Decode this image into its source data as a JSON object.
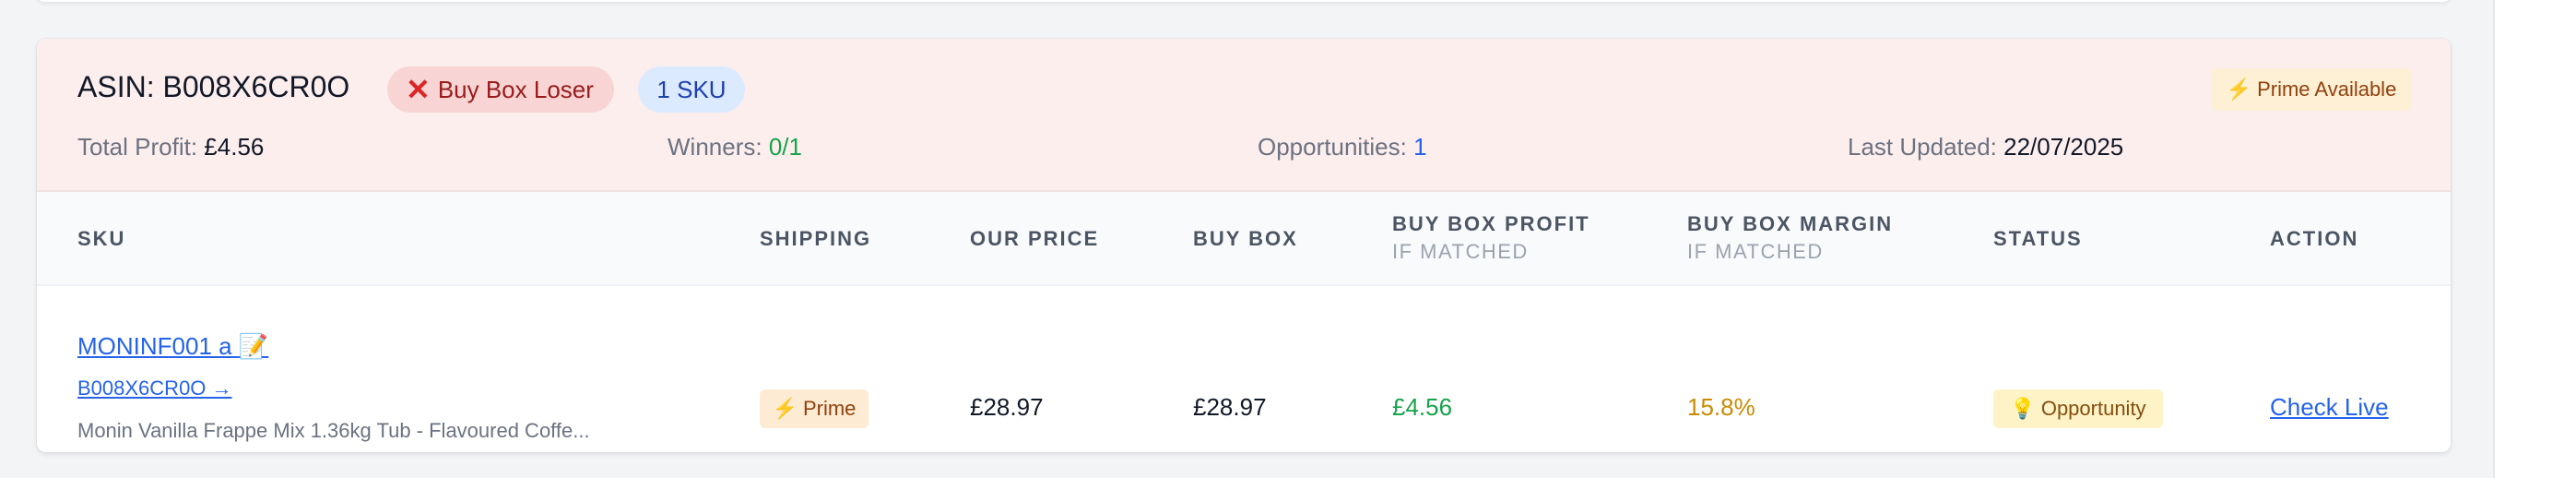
{
  "header": {
    "asin_label": "ASIN: B008X6CR0O",
    "status_badge": "Buy Box Loser",
    "sku_count_badge": "1 SKU",
    "prime_badge": "Prime Available",
    "stats": {
      "total_profit_label": "Total Profit:",
      "total_profit_value": "£4.56",
      "winners_label": "Winners:",
      "winners_value": "0/1",
      "opportunities_label": "Opportunities:",
      "opportunities_value": "1",
      "last_updated_label": "Last Updated:",
      "last_updated_value": "22/07/2025"
    }
  },
  "table": {
    "columns": {
      "sku": "SKU",
      "shipping": "SHIPPING",
      "our_price": "OUR PRICE",
      "buy_box": "BUY BOX",
      "buy_box_profit": "BUY BOX PROFIT",
      "buy_box_profit_sub": "IF MATCHED",
      "buy_box_margin": "BUY BOX MARGIN",
      "buy_box_margin_sub": "IF MATCHED",
      "status": "STATUS",
      "action": "ACTION"
    },
    "rows": [
      {
        "sku": "MONINF001 a",
        "asin_link": "B008X6CR0O →",
        "description": "Monin Vanilla Frappe Mix 1.36kg Tub - Flavoured Coffe...",
        "shipping": "Prime",
        "our_price": "£28.97",
        "buy_box": "£28.97",
        "buy_box_profit": "£4.56",
        "buy_box_margin": "15.8%",
        "status": "Opportunity",
        "action": "Check Live"
      }
    ]
  },
  "icons": {
    "loser": "x-icon",
    "prime": "lightning-icon",
    "edit": "memo-icon",
    "status": "lightbulb-icon"
  },
  "colors": {
    "header_bg": "#fdeeee",
    "link": "#2563eb",
    "profit": "#16a34a",
    "margin": "#ca8a04",
    "loser": "#dc2626"
  }
}
